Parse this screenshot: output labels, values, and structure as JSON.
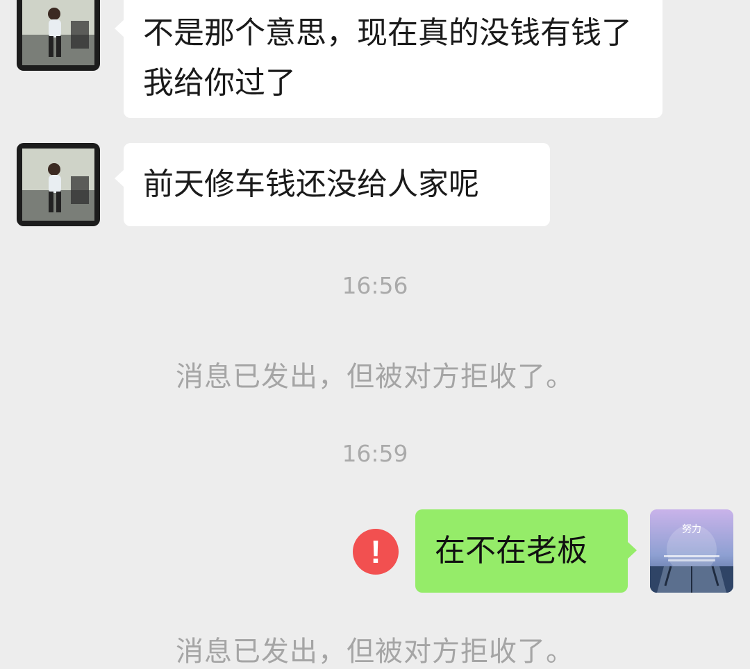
{
  "messages": [
    {
      "from": "contact",
      "text": "不是那个意思，现在真的没钱有钱了我给你过了"
    },
    {
      "from": "contact",
      "text": "前天修车钱还没给人家呢"
    }
  ],
  "timestamps": [
    "16:56",
    "16:59"
  ],
  "system_notices": [
    "消息已发出，但被对方拒收了。",
    "消息已发出，但被对方拒收了。"
  ],
  "sent_message": {
    "text": "在不在老板",
    "status_icon": "!"
  },
  "avatar_right": {
    "caption": "努力"
  },
  "colors": {
    "background": "#ededed",
    "received_bubble": "#ffffff",
    "sent_bubble": "#95ec69",
    "error": "#f25050"
  }
}
